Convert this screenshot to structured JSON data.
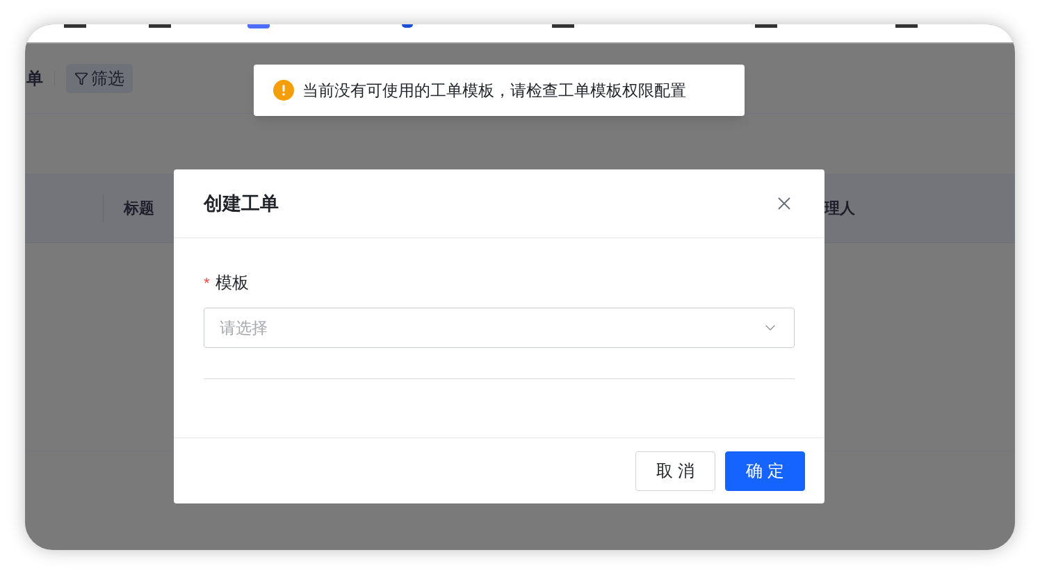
{
  "toolbar": {
    "title_fragment": "单",
    "filter_button": "筛选"
  },
  "table": {
    "columns": [
      {
        "label": "标题"
      },
      {
        "label": "理人"
      }
    ]
  },
  "toast": {
    "kind": "warning",
    "message": "当前没有可使用的工单模板，请检查工单模板权限配置"
  },
  "dialog": {
    "title": "创建工单",
    "fields": [
      {
        "label": "模板",
        "required": true,
        "required_mark": "*",
        "placeholder": "请选择"
      }
    ],
    "buttons": [
      {
        "label": "取 消",
        "kind": "default"
      },
      {
        "label": "确 定",
        "kind": "primary"
      }
    ]
  }
}
